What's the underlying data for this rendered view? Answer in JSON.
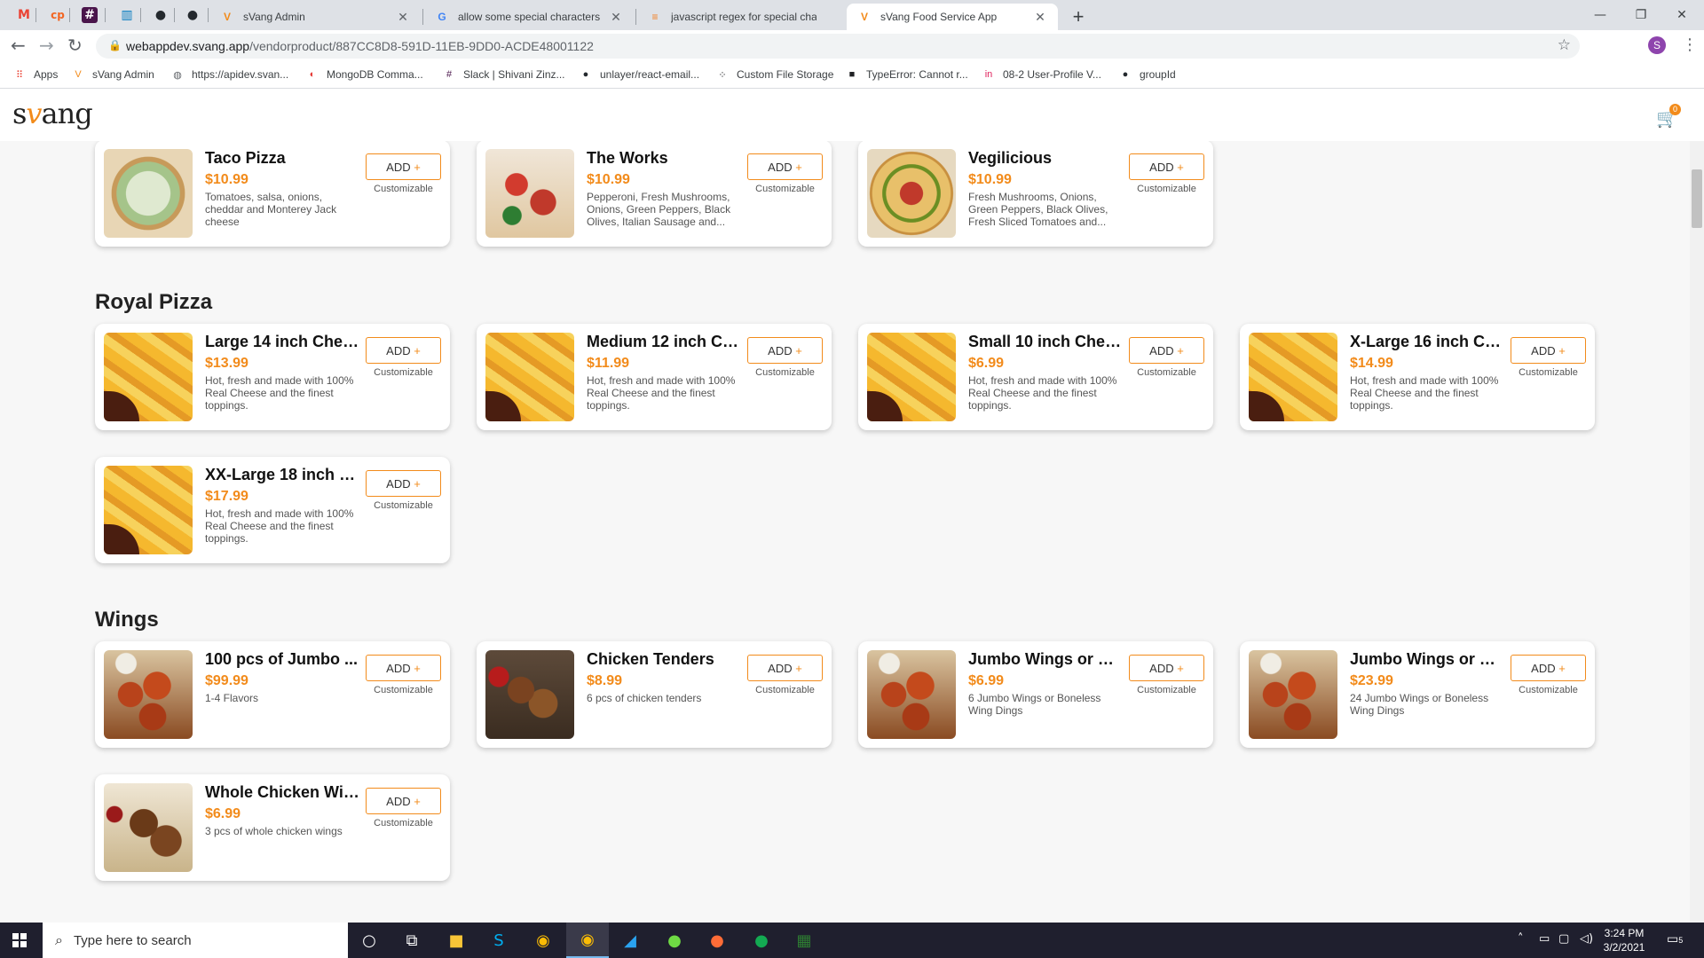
{
  "browser": {
    "pinned_tabs": [
      {
        "icon": "gmail-icon",
        "glyph": "M",
        "color": "#ea4335"
      },
      {
        "icon": "cp-icon",
        "glyph": "cp",
        "color": "#f26522"
      },
      {
        "icon": "slack-icon",
        "glyph": "#",
        "color": "#4a154b"
      },
      {
        "icon": "trello-icon",
        "glyph": "▥",
        "color": "#0079bf"
      },
      {
        "icon": "github-icon",
        "glyph": "●",
        "color": "#24292e"
      },
      {
        "icon": "github-icon",
        "glyph": "●",
        "color": "#24292e"
      }
    ],
    "tabs": [
      {
        "title": "sVang Admin",
        "icon": "svang-icon",
        "glyph": "V",
        "color": "#f28b1b"
      },
      {
        "title": "allow some special characters regex",
        "icon": "google-icon",
        "glyph": "G",
        "color": "#4285f4"
      },
      {
        "title": "javascript regex for special chara",
        "icon": "stackoverflow-icon",
        "glyph": "≡",
        "color": "#f48024"
      },
      {
        "title": "sVang Food Service App",
        "icon": "svang-icon",
        "glyph": "V",
        "color": "#f28b1b"
      }
    ],
    "url_host": "webappdev.svang.app",
    "url_path": "/vendorproduct/887CC8D8-591D-11EB-9DD0-ACDE48001122",
    "profile_initial": "S",
    "bookmarks": [
      {
        "label": "Apps",
        "icon": "apps-grid-icon",
        "glyph": "⠿",
        "color": "#ea4335"
      },
      {
        "label": "sVang Admin",
        "icon": "svang-icon",
        "glyph": "V",
        "color": "#f28b1b"
      },
      {
        "label": "https://apidev.svan...",
        "icon": "globe-icon",
        "glyph": "◍",
        "color": "#5f6368"
      },
      {
        "label": "MongoDB Comma...",
        "icon": "mongodb-icon",
        "glyph": "◐",
        "color": "#e53935"
      },
      {
        "label": "Slack | Shivani Zinz...",
        "icon": "slack-icon",
        "glyph": "#",
        "color": "#4a154b"
      },
      {
        "label": "unlayer/react-email...",
        "icon": "github-icon",
        "glyph": "●",
        "color": "#24292e"
      },
      {
        "label": "Custom File Storage",
        "icon": "storage-icon",
        "glyph": "⁘",
        "color": "#202124"
      },
      {
        "label": "TypeError: Cannot r...",
        "icon": "code-icon",
        "glyph": "■",
        "color": "#202124"
      },
      {
        "label": "08-2 User-Profile V...",
        "icon": "invision-icon",
        "glyph": "in",
        "color": "#e0245e"
      },
      {
        "label": "groupId",
        "icon": "github-icon",
        "glyph": "●",
        "color": "#24292e"
      }
    ]
  },
  "app": {
    "logo_pre": "s",
    "logo_v": "v",
    "logo_post": "ang",
    "cart_count": "0",
    "add_label": "ADD",
    "add_plus": "+",
    "customizable_label": "Customizable"
  },
  "sections": [
    {
      "title": "",
      "items": [
        {
          "name": "Taco Pizza",
          "price": "$10.99",
          "desc": "Tomatoes, salsa, onions, cheddar and Monterey Jack cheese",
          "img": "taco"
        },
        {
          "name": "The Works",
          "price": "$10.99",
          "desc": "Pepperoni, Fresh Mushrooms, Onions, Green Peppers, Black Olives, Italian Sausage and...",
          "img": "works"
        },
        {
          "name": "Vegilicious",
          "price": "$10.99",
          "desc": "Fresh Mushrooms, Onions, Green Peppers, Black Olives, Fresh Sliced Tomatoes and...",
          "img": "pizza"
        }
      ]
    },
    {
      "title": "Royal Pizza",
      "items": [
        {
          "name": "Large 14 inch Chee...",
          "price": "$13.99",
          "desc": "Hot, fresh and made with 100% Real Cheese and the finest toppings.",
          "img": "cheese"
        },
        {
          "name": "Medium 12 inch Ch...",
          "price": "$11.99",
          "desc": "Hot, fresh and made with 100% Real Cheese and the finest toppings.",
          "img": "cheese"
        },
        {
          "name": "Small 10 inch Chee...",
          "price": "$6.99",
          "desc": "Hot, fresh and made with 100% Real Cheese and the finest toppings.",
          "img": "cheese"
        },
        {
          "name": "X-Large 16 inch Ch...",
          "price": "$14.99",
          "desc": "Hot, fresh and made with 100% Real Cheese and the finest toppings.",
          "img": "cheese"
        },
        {
          "name": "XX-Large 18 inch C...",
          "price": "$17.99",
          "desc": "Hot, fresh and made with 100% Real Cheese and the finest toppings.",
          "img": "cheese"
        }
      ]
    },
    {
      "title": "Wings",
      "items": [
        {
          "name": "100 pcs of Jumbo ...",
          "price": "$99.99",
          "desc": "1-4 Flavors",
          "img": "wings"
        },
        {
          "name": "Chicken Tenders",
          "price": "$8.99",
          "desc": "6 pcs of chicken tenders",
          "img": "tenders"
        },
        {
          "name": "Jumbo Wings or Bo...",
          "price": "$6.99",
          "desc": "6 Jumbo Wings or Boneless Wing Dings",
          "img": "wings"
        },
        {
          "name": "Jumbo Wings or Bo...",
          "price": "$23.99",
          "desc": "24 Jumbo Wings or Boneless Wing Dings",
          "img": "wings"
        },
        {
          "name": "Whole Chicken Win...",
          "price": "$6.99",
          "desc": "3 pcs of whole chicken wings",
          "img": "whole"
        }
      ]
    }
  ],
  "taskbar": {
    "search_placeholder": "Type here to search",
    "time": "3:24 PM",
    "date": "3/2/2021",
    "notification_count": "5"
  },
  "colors": {
    "accent": "#f28b1b",
    "taskbar": "#1f1f2e"
  }
}
